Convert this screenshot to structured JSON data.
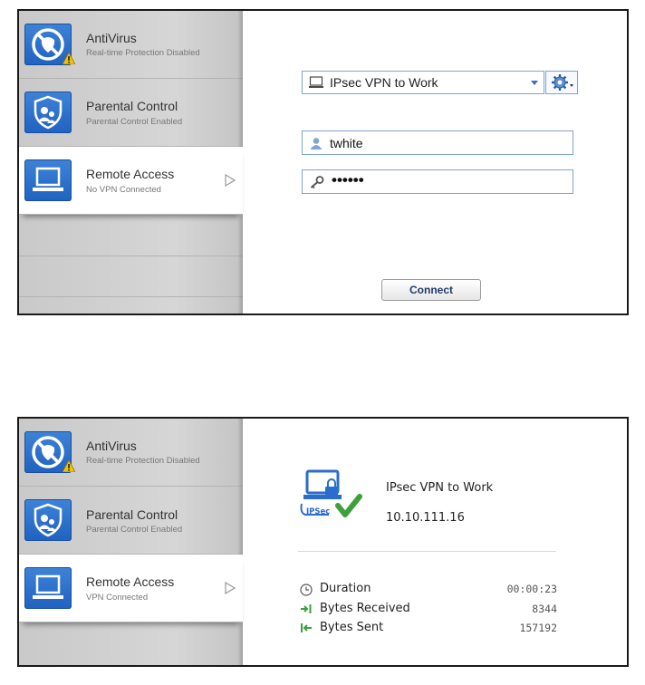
{
  "colors": {
    "accent_blue": "#2a6dcc",
    "field_border": "#7fa4cf",
    "sidebar_bg": "#d0d0d0",
    "warning_yellow": "#f2c200",
    "ok_green": "#3ca03c"
  },
  "panel_disconnected": {
    "sidebar": {
      "items": [
        {
          "icon": "antivirus-shield-icon",
          "title": "AntiVirus",
          "subtitle": "Real-time Protection Disabled",
          "badge": "warning-icon"
        },
        {
          "icon": "parental-control-icon",
          "title": "Parental Control",
          "subtitle": "Parental Control Enabled"
        },
        {
          "icon": "remote-access-monitor-icon",
          "title": "Remote Access",
          "subtitle": "No VPN Connected",
          "active": true
        }
      ]
    },
    "form": {
      "connection_selected": "IPsec VPN to Work",
      "username": "twhite",
      "password_mask": "••••••",
      "connect_label": "Connect"
    }
  },
  "panel_connected": {
    "sidebar": {
      "items": [
        {
          "icon": "antivirus-shield-icon",
          "title": "AntiVirus",
          "subtitle": "Real-time Protection Disabled",
          "badge": "warning-icon"
        },
        {
          "icon": "parental-control-icon",
          "title": "Parental Control",
          "subtitle": "Parental Control Enabled"
        },
        {
          "icon": "remote-access-monitor-icon",
          "title": "Remote Access",
          "subtitle": "VPN Connected",
          "active": true
        }
      ]
    },
    "status": {
      "icon_label": "IPSec",
      "connection_name": "IPsec VPN to Work",
      "ip_address": "10.10.111.16",
      "stats": [
        {
          "icon": "clock-icon",
          "label": "Duration",
          "value": "00:00:23"
        },
        {
          "icon": "arrow-in-icon",
          "label": "Bytes Received",
          "value": "8344"
        },
        {
          "icon": "arrow-out-icon",
          "label": "Bytes Sent",
          "value": "157192"
        }
      ]
    }
  }
}
